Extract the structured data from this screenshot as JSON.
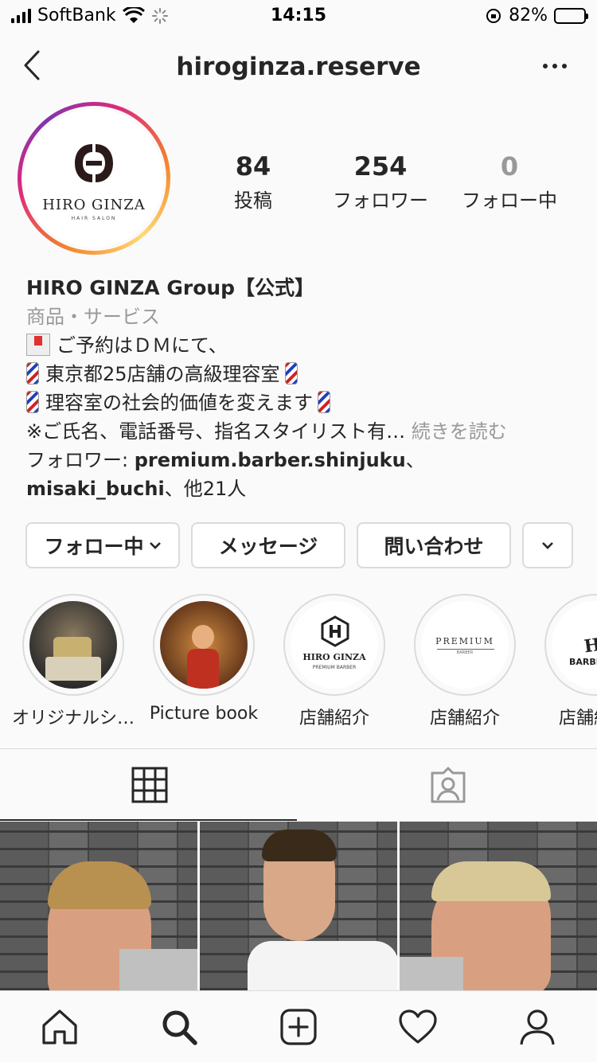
{
  "status_bar": {
    "carrier": "SoftBank",
    "time": "14:15",
    "battery_percent": "82%",
    "battery_level": 0.82
  },
  "header": {
    "username": "hiroginza.reserve"
  },
  "profile": {
    "avatar_brand": "HIRO GINZA",
    "avatar_subtitle": "HAIR SALON",
    "stats": [
      {
        "value": "84",
        "label": "投稿"
      },
      {
        "value": "254",
        "label": "フォロワー"
      },
      {
        "value": "0",
        "label": "フォロー中"
      }
    ],
    "name": "HIRO GINZA Group【公式】",
    "category": "商品・サービス",
    "bio_lines": [
      "ご予約はＤＭにて、",
      "東京都25店舗の高級理容室",
      "理容室の社会的価値を変えます"
    ],
    "bio_truncated": "※ご氏名、電話番号、指名スタイリスト有…",
    "read_more": "続きを読む",
    "followed_by_prefix": "フォロワー: ",
    "followed_by_user1": "premium.barber.shinjuku",
    "followed_by_sep": "、",
    "followed_by_user2": "misaki_buchi",
    "followed_by_suffix": "、他21人"
  },
  "actions": {
    "following_label": "フォロー中",
    "message_label": "メッセージ",
    "contact_label": "問い合わせ"
  },
  "highlights": [
    {
      "label": "オリジナルシ…"
    },
    {
      "label": "Picture book"
    },
    {
      "label": "店舗紹介",
      "logo": "HIRO GINZA",
      "logo_sub": "PREMIUM BARBER"
    },
    {
      "label": "店舗紹介",
      "logo": "PREMIUM",
      "logo_sub": "BARBER"
    },
    {
      "label": "店舗紹",
      "logo": "HIRO G",
      "logo_sub": "BARBER"
    }
  ],
  "colors": {
    "text": "#262626",
    "muted": "#999999",
    "border": "#dbdbdb",
    "background": "#fafafa"
  }
}
